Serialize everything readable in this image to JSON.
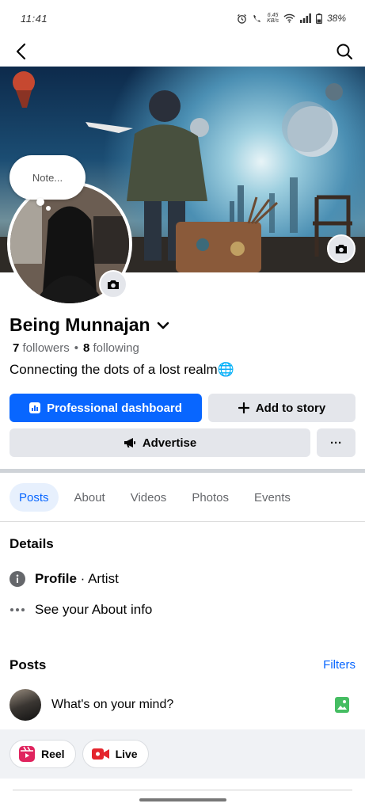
{
  "status_bar": {
    "time": "11:41",
    "speed_top": "6.45",
    "speed_unit": "KB/s",
    "battery": "38%"
  },
  "profile": {
    "name": "Being Munnajan",
    "followers_count": "7",
    "followers_label": "followers",
    "following_count": "8",
    "following_label": "following",
    "bio": "Connecting the dots of a lost realm🌐",
    "note_placeholder": "Note..."
  },
  "actions": {
    "dashboard_label": "Professional dashboard",
    "add_story_label": "Add to story",
    "advertise_label": "Advertise",
    "more_label": "···"
  },
  "tabs": [
    {
      "label": "Posts",
      "active": true
    },
    {
      "label": "About",
      "active": false
    },
    {
      "label": "Videos",
      "active": false
    },
    {
      "label": "Photos",
      "active": false
    },
    {
      "label": "Events",
      "active": false
    }
  ],
  "details": {
    "title": "Details",
    "profile_label": "Profile",
    "profile_separator": " · ",
    "profile_value": "Artist",
    "about_link": "See your About info"
  },
  "posts": {
    "title": "Posts",
    "filters_label": "Filters",
    "composer_prompt": "What's on your mind?",
    "reel_label": "Reel",
    "live_label": "Live"
  },
  "colors": {
    "accent": "#0866ff",
    "button_gray": "#e4e6eb",
    "reel": "#e0245e",
    "live": "#e4252d",
    "photo": "#45bd62"
  }
}
